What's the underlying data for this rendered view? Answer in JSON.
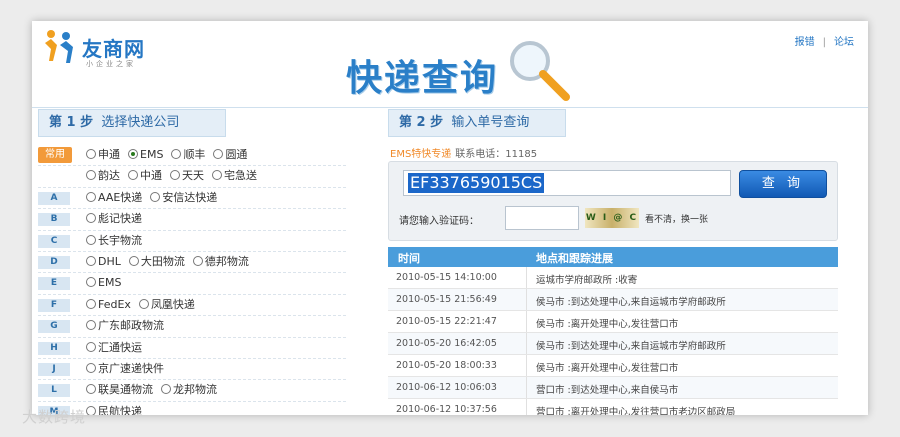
{
  "header": {
    "logo_text": "友商网",
    "logo_sub": "小企业之家",
    "title": "快递查询",
    "links": [
      "报错",
      "论坛"
    ],
    "link_sep": "|"
  },
  "step1": {
    "num": "第 1 步",
    "label": "选择快递公司"
  },
  "step2": {
    "num": "第 2 步",
    "label": "输入单号查询"
  },
  "companies": {
    "common_label": "常用",
    "common_rows": [
      [
        {
          "name": "申通",
          "selected": false
        },
        {
          "name": "EMS",
          "selected": true
        },
        {
          "name": "顺丰",
          "selected": false
        },
        {
          "name": "圆通",
          "selected": false
        }
      ],
      [
        {
          "name": "韵达",
          "selected": false
        },
        {
          "name": "中通",
          "selected": false
        },
        {
          "name": "天天",
          "selected": false
        },
        {
          "name": "宅急送",
          "selected": false
        }
      ]
    ],
    "letter_rows": [
      {
        "letter": "A",
        "items": [
          "AAE快递",
          "安信达快递"
        ]
      },
      {
        "letter": "B",
        "items": [
          "彪记快递"
        ]
      },
      {
        "letter": "C",
        "items": [
          "长宇物流"
        ]
      },
      {
        "letter": "D",
        "items": [
          "DHL",
          "大田物流",
          "德邦物流"
        ]
      },
      {
        "letter": "E",
        "items": [
          "EMS"
        ]
      },
      {
        "letter": "F",
        "items": [
          "FedEx",
          "凤凰快递"
        ]
      },
      {
        "letter": "G",
        "items": [
          "广东邮政物流"
        ]
      },
      {
        "letter": "H",
        "items": [
          "汇通快运"
        ]
      },
      {
        "letter": "J",
        "items": [
          "京广速递快件"
        ]
      },
      {
        "letter": "L",
        "items": [
          "联昊通物流",
          "龙邦物流"
        ]
      },
      {
        "letter": "M",
        "items": [
          "民航快递"
        ]
      }
    ]
  },
  "query": {
    "ems_label": "EMS特快专递",
    "tel": "联系电话：11185",
    "tracking_number": "EF337659015CS",
    "button": "查 询",
    "captcha_label": "请您输入验证码：",
    "captcha_input": "",
    "captcha_text": "W I @ C",
    "refresh_text": "看不清，换一张"
  },
  "table": {
    "headers": [
      "时间",
      "地点和跟踪进展"
    ],
    "rows": [
      {
        "time": "2010-05-15   14:10:00",
        "loc": "运城市学府邮政所 :收寄"
      },
      {
        "time": "2010-05-15   21:56:49",
        "loc": "侯马市 :到达处理中心,来自运城市学府邮政所"
      },
      {
        "time": "2010-05-15   22:21:47",
        "loc": "侯马市 :离开处理中心,发往营口市"
      },
      {
        "time": "2010-05-20   16:42:05",
        "loc": "侯马市 :到达处理中心,来自运城市学府邮政所"
      },
      {
        "time": "2010-05-20   18:00:33",
        "loc": "侯马市 :离开处理中心,发往营口市"
      },
      {
        "time": "2010-06-12   10:06:03",
        "loc": "营口市 :到达处理中心,来自侯马市"
      },
      {
        "time": "2010-06-12   10:37:56",
        "loc": "营口市 :离开处理中心,发往营口市老边区邮政局"
      }
    ]
  },
  "watermark": "大数跨境",
  "colors": {
    "accent": "#2a7fc8",
    "ems_orange": "#f08a2a",
    "table_header": "#4a9ddb",
    "common_badge": "#f29a3a"
  }
}
